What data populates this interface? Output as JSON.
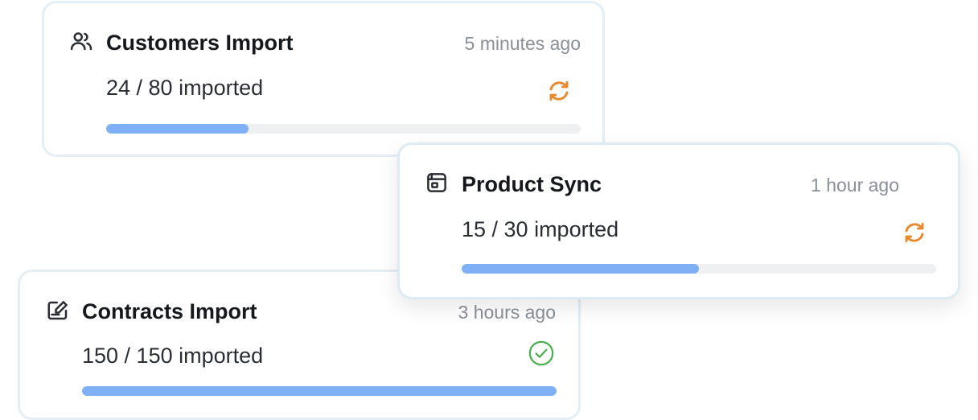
{
  "colors": {
    "progress": "#7fb0f5",
    "syncing": "#e8892e",
    "complete": "#4caf50",
    "muted": "#8a9099"
  },
  "imports": [
    {
      "title": "Customers Import",
      "time": "5 minutes ago",
      "count_text": "24 / 80 imported",
      "imported": 24,
      "total": 80,
      "progress": 0.3,
      "icon": "users-icon",
      "status": "syncing",
      "status_icon": "sync-icon"
    },
    {
      "title": "Product Sync",
      "time": "1 hour ago",
      "count_text": "15 / 30 imported",
      "imported": 15,
      "total": 30,
      "progress": 0.5,
      "icon": "package-icon",
      "status": "syncing",
      "status_icon": "sync-icon"
    },
    {
      "title": "Contracts Import",
      "time": "3 hours ago",
      "count_text": "150 / 150 imported",
      "imported": 150,
      "total": 150,
      "progress": 1.0,
      "icon": "signature-icon",
      "status": "complete",
      "status_icon": "check-circle-icon"
    }
  ]
}
